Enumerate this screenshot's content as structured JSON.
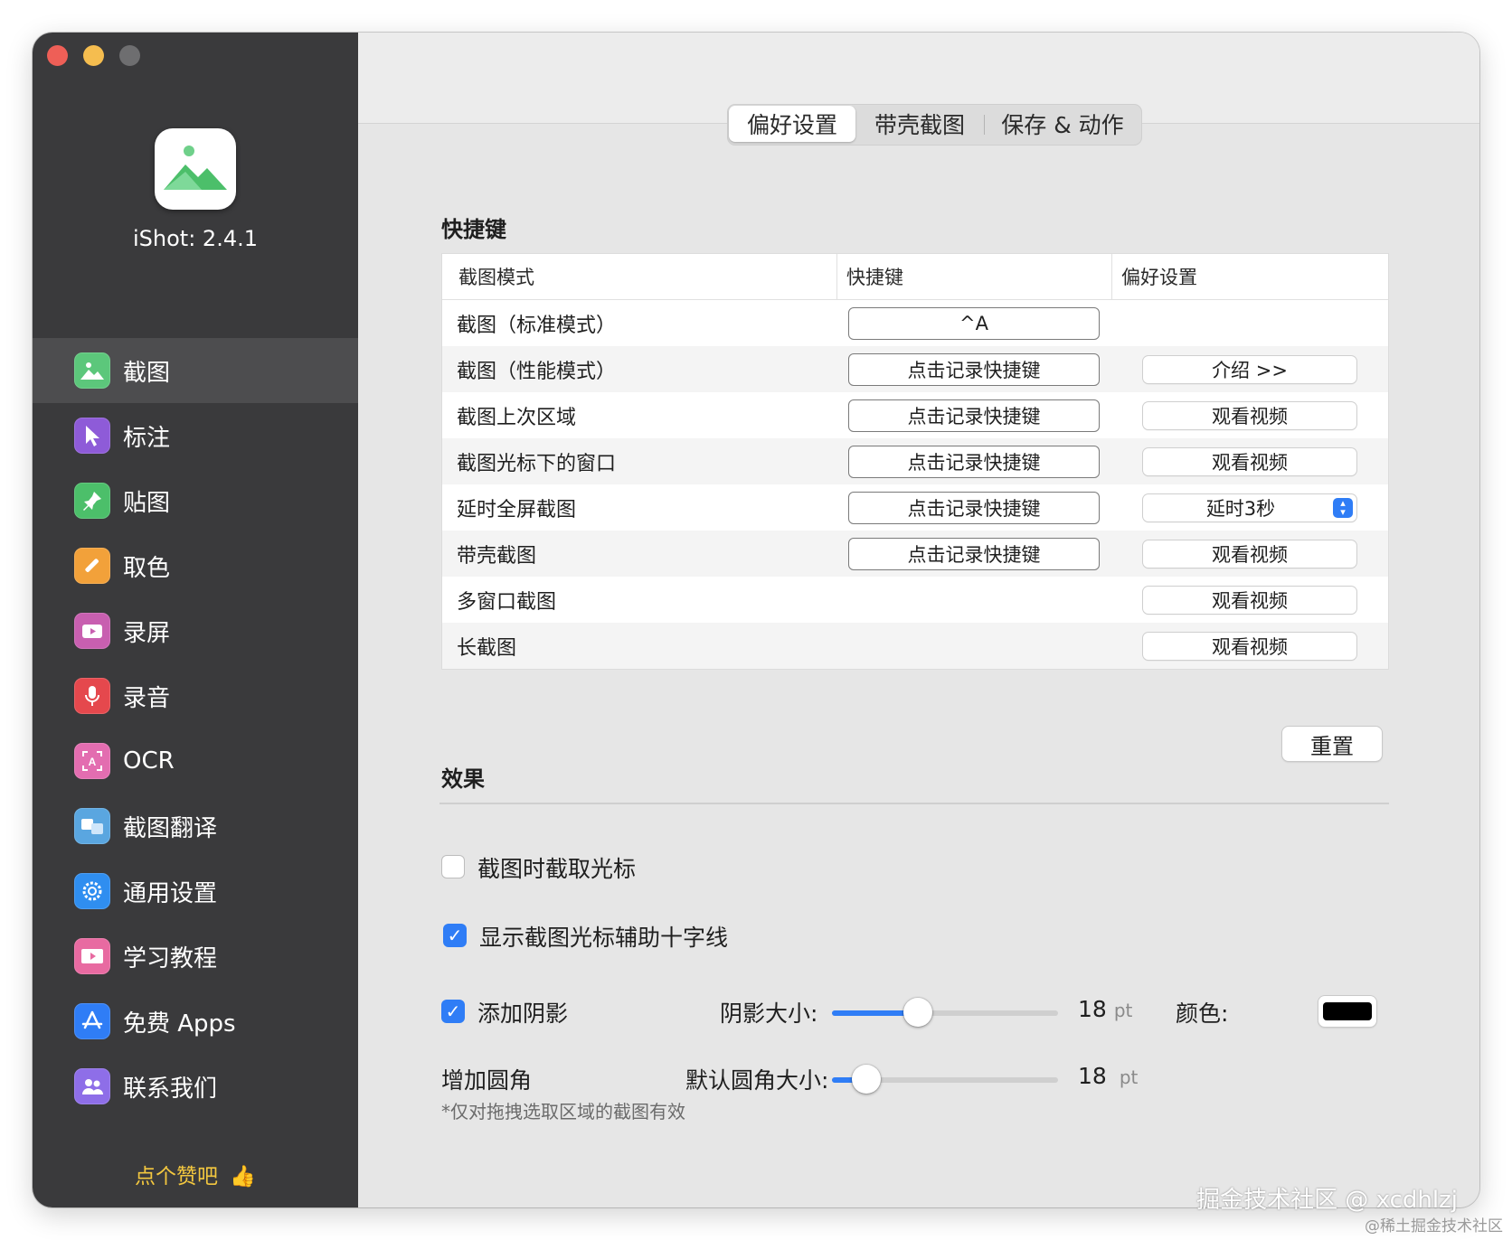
{
  "sidebar": {
    "app_version": "iShot: 2.4.1",
    "items": [
      {
        "label": "截图",
        "icon": "mountain-image-icon",
        "color": "#5cc77b",
        "active": true
      },
      {
        "label": "标注",
        "icon": "cursor-arrow-icon",
        "color": "#8e5bd8",
        "active": false
      },
      {
        "label": "贴图",
        "icon": "pin-icon",
        "color": "#4cbf6a",
        "active": false
      },
      {
        "label": "取色",
        "icon": "eyedropper-icon",
        "color": "#f2a13a",
        "active": false
      },
      {
        "label": "录屏",
        "icon": "video-camera-icon",
        "color": "#c85fb0",
        "active": false
      },
      {
        "label": "录音",
        "icon": "microphone-icon",
        "color": "#e5484d",
        "active": false
      },
      {
        "label": "OCR",
        "icon": "ocr-text-icon",
        "color": "#e36db0",
        "active": false
      },
      {
        "label": "截图翻译",
        "icon": "translate-icon",
        "color": "#5aa6e0",
        "active": false
      },
      {
        "label": "通用设置",
        "icon": "gear-icon",
        "color": "#2f8ef0",
        "active": false
      },
      {
        "label": "学习教程",
        "icon": "film-tutorial-icon",
        "color": "#e86aa1",
        "active": false
      },
      {
        "label": "免费 Apps",
        "icon": "app-store-icon",
        "color": "#2f7df6",
        "active": false
      },
      {
        "label": "联系我们",
        "icon": "contacts-icon",
        "color": "#8e6ee8",
        "active": false
      }
    ],
    "like_label": "点个赞吧"
  },
  "tabs": [
    {
      "label": "偏好设置",
      "active": true
    },
    {
      "label": "带壳截图",
      "active": false
    },
    {
      "label": "保存 & 动作",
      "active": false
    }
  ],
  "shortcuts": {
    "title": "快捷键",
    "headers": [
      "截图模式",
      "快捷键",
      "偏好设置"
    ],
    "rows": [
      {
        "name": "截图（标准模式）",
        "key": "^A",
        "pref": null
      },
      {
        "name": "截图（性能模式）",
        "key": "点击记录快捷键",
        "pref": "介绍  >>"
      },
      {
        "name": "截图上次区域",
        "key": "点击记录快捷键",
        "pref": "观看视频"
      },
      {
        "name": "截图光标下的窗口",
        "key": "点击记录快捷键",
        "pref": "观看视频"
      },
      {
        "name": "延时全屏截图",
        "key": "点击记录快捷键",
        "pref": "延时3秒",
        "pref_is_select": true
      },
      {
        "name": "带壳截图",
        "key": "点击记录快捷键",
        "pref": "观看视频"
      },
      {
        "name": "多窗口截图",
        "key": null,
        "pref": "观看视频"
      },
      {
        "name": "长截图",
        "key": null,
        "pref": "观看视频"
      }
    ],
    "reset_label": "重置"
  },
  "effects": {
    "title": "效果",
    "capture_cursor": {
      "label": "截图时截取光标",
      "checked": false
    },
    "crosshair": {
      "label": "显示截图光标辅助十字线",
      "checked": true
    },
    "shadow": {
      "label": "添加阴影",
      "checked": true,
      "size_label": "阴影大小:",
      "value": "18",
      "unit": "pt",
      "fraction": 0.38,
      "color_label": "颜色:",
      "color": "#000000"
    },
    "corner": {
      "label": "增加圆角",
      "size_label": "默认圆角大小:",
      "value": "18",
      "unit": "pt",
      "fraction": 0.15,
      "note": "*仅对拖拽选取区域的截图有效"
    }
  },
  "watermark": {
    "main": "掘金技术社区 @ xcdhlzj",
    "sub": "@稀土掘金技术社区"
  }
}
